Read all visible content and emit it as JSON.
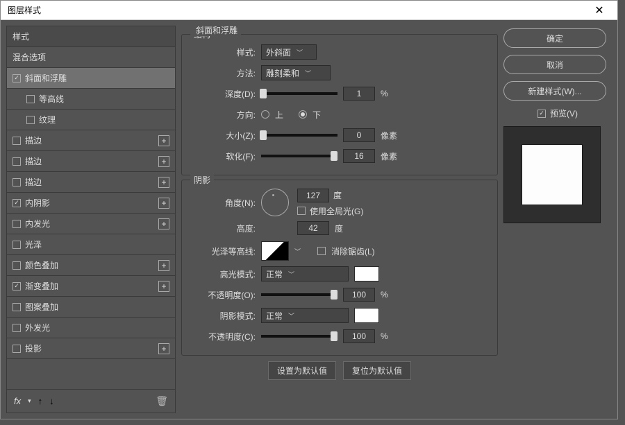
{
  "title": "图层样式",
  "sidebar": {
    "header": "样式",
    "blend": "混合选项",
    "items": [
      {
        "label": "斜面和浮雕",
        "checked": true,
        "plus": false,
        "selected": true
      },
      {
        "label": "等高线",
        "checked": false,
        "plus": false,
        "indent": true
      },
      {
        "label": "纹理",
        "checked": false,
        "plus": false,
        "indent": true
      },
      {
        "label": "描边",
        "checked": false,
        "plus": true
      },
      {
        "label": "描边",
        "checked": false,
        "plus": true
      },
      {
        "label": "描边",
        "checked": false,
        "plus": true
      },
      {
        "label": "内阴影",
        "checked": true,
        "plus": true
      },
      {
        "label": "内发光",
        "checked": false,
        "plus": true
      },
      {
        "label": "光泽",
        "checked": false,
        "plus": false
      },
      {
        "label": "颜色叠加",
        "checked": false,
        "plus": true
      },
      {
        "label": "渐变叠加",
        "checked": true,
        "plus": true
      },
      {
        "label": "图案叠加",
        "checked": false,
        "plus": false
      },
      {
        "label": "外发光",
        "checked": false,
        "plus": false
      },
      {
        "label": "投影",
        "checked": false,
        "plus": true
      }
    ],
    "fx": "fx"
  },
  "main": {
    "title": "斜面和浮雕",
    "structure": {
      "legend": "结构",
      "style_label": "样式:",
      "style_val": "外斜面",
      "technique_label": "方法:",
      "technique_val": "雕刻柔和",
      "depth_label": "深度(D):",
      "depth_val": "1",
      "depth_unit": "%",
      "direction_label": "方向:",
      "up": "上",
      "down": "下",
      "size_label": "大小(Z):",
      "size_val": "0",
      "size_unit": "像素",
      "soften_label": "软化(F):",
      "soften_val": "16",
      "soften_unit": "像素"
    },
    "shading": {
      "legend": "阴影",
      "angle_label": "角度(N):",
      "angle_val": "127",
      "angle_unit": "度",
      "global_light": "使用全局光(G)",
      "altitude_label": "高度:",
      "altitude_val": "42",
      "altitude_unit": "度",
      "gloss_label": "光泽等高线:",
      "antialias": "消除锯齿(L)",
      "highlight_mode_label": "高光模式:",
      "highlight_mode_val": "正常",
      "opacity_o_label": "不透明度(O):",
      "opacity_o_val": "100",
      "opacity_o_unit": "%",
      "shadow_mode_label": "阴影模式:",
      "shadow_mode_val": "正常",
      "opacity_c_label": "不透明度(C):",
      "opacity_c_val": "100",
      "opacity_c_unit": "%"
    },
    "set_default": "设置为默认值",
    "reset_default": "复位为默认值"
  },
  "buttons": {
    "ok": "确定",
    "cancel": "取消",
    "new_style": "新建样式(W)...",
    "preview": "预览(V)"
  }
}
